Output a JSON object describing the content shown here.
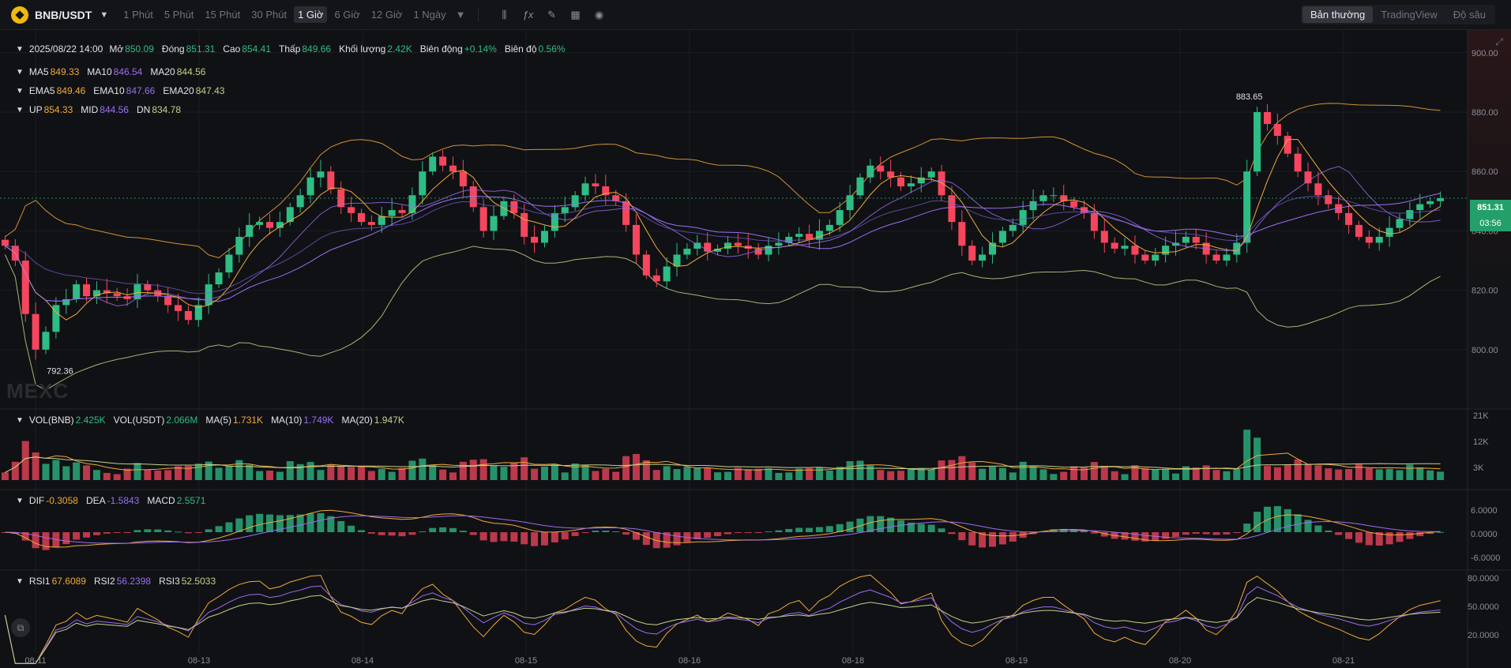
{
  "toolbar": {
    "pair": "BNB/USDT",
    "intervals": [
      "1 Phút",
      "5 Phút",
      "15 Phút",
      "30 Phút",
      "1 Giờ",
      "6 Giờ",
      "12 Giờ",
      "1 Ngày"
    ],
    "active_interval": "1 Giờ",
    "tool_icons": [
      "indicator-bars-icon",
      "fx-icon",
      "pencil-icon",
      "layout-grid-icon",
      "camera-icon"
    ],
    "view_tabs": [
      "Bản thường",
      "TradingView",
      "Độ sâu"
    ],
    "active_view": "Bản thường"
  },
  "ohlc": {
    "date": "2025/08/22 14:00",
    "open_label": "Mở",
    "open": "850.09",
    "close_label": "Đóng",
    "close": "851.31",
    "high_label": "Cao",
    "high": "854.41",
    "low_label": "Thấp",
    "low": "849.66",
    "volume_label": "Khối lượng",
    "volume": "2.42K",
    "change_label": "Biên động",
    "change": "+0.14%",
    "amplitude_label": "Biên độ",
    "amplitude": "0.56%"
  },
  "ma": {
    "ma5_label": "MA5",
    "ma5": "849.33",
    "ma10_label": "MA10",
    "ma10": "846.54",
    "ma20_label": "MA20",
    "ma20": "844.56"
  },
  "ema": {
    "ema5_label": "EMA5",
    "ema5": "849.46",
    "ema10_label": "EMA10",
    "ema10": "847.66",
    "ema20_label": "EMA20",
    "ema20": "847.43"
  },
  "boll": {
    "up_label": "UP",
    "up": "854.33",
    "mid_label": "MID",
    "mid": "844.56",
    "dn_label": "DN",
    "dn": "834.78"
  },
  "vol": {
    "vol_bnb_label": "VOL(BNB)",
    "vol_bnb": "2.425K",
    "vol_usdt_label": "VOL(USDT)",
    "vol_usdt": "2.066M",
    "ma5_label": "MA(5)",
    "ma5": "1.731K",
    "ma10_label": "MA(10)",
    "ma10": "1.749K",
    "ma20_label": "MA(20)",
    "ma20": "1.947K"
  },
  "macd": {
    "dif_label": "DIF",
    "dif": "-0.3058",
    "dea_label": "DEA",
    "dea": "-1.5843",
    "macd_label": "MACD",
    "macd": "2.5571"
  },
  "rsi": {
    "rsi1_label": "RSI1",
    "rsi1": "67.6089",
    "rsi2_label": "RSI2",
    "rsi2": "56.2398",
    "rsi3_label": "RSI3",
    "rsi3": "52.5033"
  },
  "price_axis": [
    "900.00",
    "880.00",
    "860.00",
    "840.00",
    "820.00",
    "800.00"
  ],
  "vol_axis": [
    "21K",
    "12K",
    "3K"
  ],
  "macd_axis": [
    "6.0000",
    "0.0000",
    "-6.0000"
  ],
  "rsi_axis": [
    "80.0000",
    "50.0000",
    "20.0000"
  ],
  "time_axis": [
    "08-11",
    "08-13",
    "08-14",
    "08-15",
    "08-16",
    "08-18",
    "08-19",
    "08-20",
    "08-21"
  ],
  "markers": {
    "high": "883.65",
    "low": "792.36"
  },
  "current_price": {
    "price": "851.31",
    "countdown": "03:56"
  },
  "watermark": "MEXC",
  "colors": {
    "up": "#2ebd85",
    "down": "#f6465d",
    "ma5": "#f0a93b",
    "ma10": "#9b6ef3",
    "ma20": "#c4cf8a"
  },
  "chart_data": {
    "type": "candlestick",
    "y_range": [
      780,
      905
    ],
    "close_series": [
      835,
      830,
      812,
      800,
      806,
      815,
      817,
      822,
      818,
      820,
      819,
      818,
      817,
      822,
      820,
      818,
      815,
      813,
      810,
      815,
      822,
      826,
      832,
      838,
      842,
      843,
      841,
      843,
      848,
      852,
      858,
      860,
      854,
      848,
      846,
      843,
      842,
      845,
      847,
      846,
      852,
      860,
      865,
      862,
      860,
      855,
      848,
      840,
      845,
      850,
      846,
      838,
      836,
      840,
      846,
      848,
      852,
      856,
      855,
      852,
      850,
      842,
      832,
      825,
      823,
      828,
      832,
      834,
      836,
      833,
      834,
      836,
      835,
      834,
      832,
      835,
      836,
      838,
      839,
      837,
      840,
      842,
      847,
      852,
      858,
      862,
      860,
      858,
      855,
      856,
      858,
      860,
      852,
      843,
      835,
      830,
      832,
      836,
      840,
      842,
      847,
      850,
      852,
      852,
      850,
      848,
      846,
      840,
      836,
      834,
      835,
      832,
      830,
      832,
      835,
      836,
      838,
      836,
      832,
      830,
      832,
      836,
      860,
      880,
      876,
      872,
      866,
      860,
      856,
      852,
      849,
      846,
      842,
      838,
      836,
      838,
      841,
      844,
      847,
      849,
      850,
      851
    ]
  }
}
